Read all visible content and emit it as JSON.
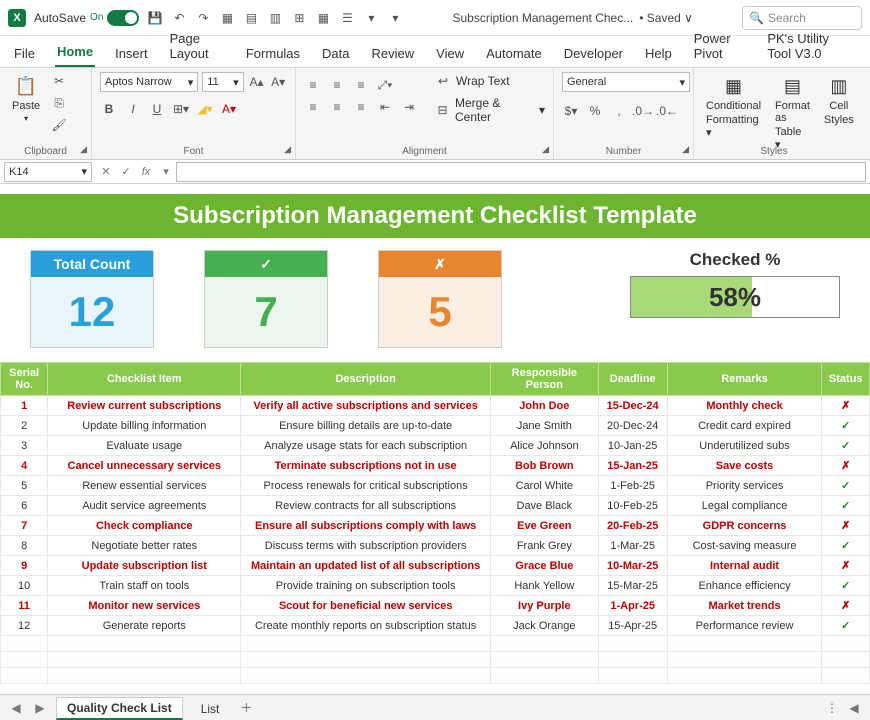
{
  "titlebar": {
    "autosave_label": "AutoSave",
    "autosave_state": "On",
    "doc_name": "Subscription Management Chec...",
    "saved_label": "• Saved ∨",
    "search_placeholder": "Search"
  },
  "ribbon_tabs": [
    "File",
    "Home",
    "Insert",
    "Page Layout",
    "Formulas",
    "Data",
    "Review",
    "View",
    "Automate",
    "Developer",
    "Help",
    "Power Pivot",
    "PK's Utility Tool V3.0"
  ],
  "active_tab": "Home",
  "ribbon": {
    "paste_label": "Paste",
    "clipboard_label": "Clipboard",
    "font_name": "Aptos Narrow",
    "font_size": "11",
    "font_label": "Font",
    "wrap_label": "Wrap Text",
    "merge_label": "Merge & Center",
    "alignment_label": "Alignment",
    "number_format": "General",
    "number_label": "Number",
    "cond_fmt_label1": "Conditional",
    "cond_fmt_label2": "Formatting",
    "fmt_table_label1": "Format as",
    "fmt_table_label2": "Table",
    "cell_styles_label1": "Cell",
    "cell_styles_label2": "Styles",
    "styles_label": "Styles"
  },
  "name_box": "K14",
  "banner_title": "Subscription Management Checklist Template",
  "cards": {
    "total_label": "Total Count",
    "total_value": "12",
    "check_symbol": "✓",
    "check_value": "7",
    "cross_symbol": "✗",
    "cross_value": "5",
    "pct_label": "Checked %",
    "pct_value": "58%",
    "pct_width": "58%"
  },
  "table": {
    "headers": [
      "Serial No.",
      "Checklist Item",
      "Description",
      "Responsible Person",
      "Deadline",
      "Remarks",
      "Status"
    ],
    "rows": [
      {
        "n": "1",
        "item": "Review current subscriptions",
        "desc": "Verify all active subscriptions and services",
        "person": "John Doe",
        "deadline": "15-Dec-24",
        "remarks": "Monthly check",
        "status": "✗",
        "pending": true
      },
      {
        "n": "2",
        "item": "Update billing information",
        "desc": "Ensure billing details are up-to-date",
        "person": "Jane Smith",
        "deadline": "20-Dec-24",
        "remarks": "Credit card expired",
        "status": "✓",
        "pending": false
      },
      {
        "n": "3",
        "item": "Evaluate usage",
        "desc": "Analyze usage stats for each subscription",
        "person": "Alice Johnson",
        "deadline": "10-Jan-25",
        "remarks": "Underutilized subs",
        "status": "✓",
        "pending": false
      },
      {
        "n": "4",
        "item": "Cancel unnecessary services",
        "desc": "Terminate subscriptions not in use",
        "person": "Bob Brown",
        "deadline": "15-Jan-25",
        "remarks": "Save costs",
        "status": "✗",
        "pending": true
      },
      {
        "n": "5",
        "item": "Renew essential services",
        "desc": "Process renewals for critical subscriptions",
        "person": "Carol White",
        "deadline": "1-Feb-25",
        "remarks": "Priority services",
        "status": "✓",
        "pending": false
      },
      {
        "n": "6",
        "item": "Audit service agreements",
        "desc": "Review contracts for all subscriptions",
        "person": "Dave Black",
        "deadline": "10-Feb-25",
        "remarks": "Legal compliance",
        "status": "✓",
        "pending": false
      },
      {
        "n": "7",
        "item": "Check compliance",
        "desc": "Ensure all subscriptions comply with laws",
        "person": "Eve Green",
        "deadline": "20-Feb-25",
        "remarks": "GDPR concerns",
        "status": "✗",
        "pending": true
      },
      {
        "n": "8",
        "item": "Negotiate better rates",
        "desc": "Discuss terms with subscription providers",
        "person": "Frank Grey",
        "deadline": "1-Mar-25",
        "remarks": "Cost-saving measure",
        "status": "✓",
        "pending": false
      },
      {
        "n": "9",
        "item": "Update subscription list",
        "desc": "Maintain an updated list of all subscriptions",
        "person": "Grace Blue",
        "deadline": "10-Mar-25",
        "remarks": "Internal audit",
        "status": "✗",
        "pending": true
      },
      {
        "n": "10",
        "item": "Train staff on tools",
        "desc": "Provide training on subscription tools",
        "person": "Hank Yellow",
        "deadline": "15-Mar-25",
        "remarks": "Enhance efficiency",
        "status": "✓",
        "pending": false
      },
      {
        "n": "11",
        "item": "Monitor new services",
        "desc": "Scout for beneficial new services",
        "person": "Ivy Purple",
        "deadline": "1-Apr-25",
        "remarks": "Market trends",
        "status": "✗",
        "pending": true
      },
      {
        "n": "12",
        "item": "Generate reports",
        "desc": "Create monthly reports on subscription status",
        "person": "Jack Orange",
        "deadline": "15-Apr-25",
        "remarks": "Performance review",
        "status": "✓",
        "pending": false
      }
    ]
  },
  "sheet_tabs": {
    "active": "Quality Check List",
    "other": "List"
  }
}
